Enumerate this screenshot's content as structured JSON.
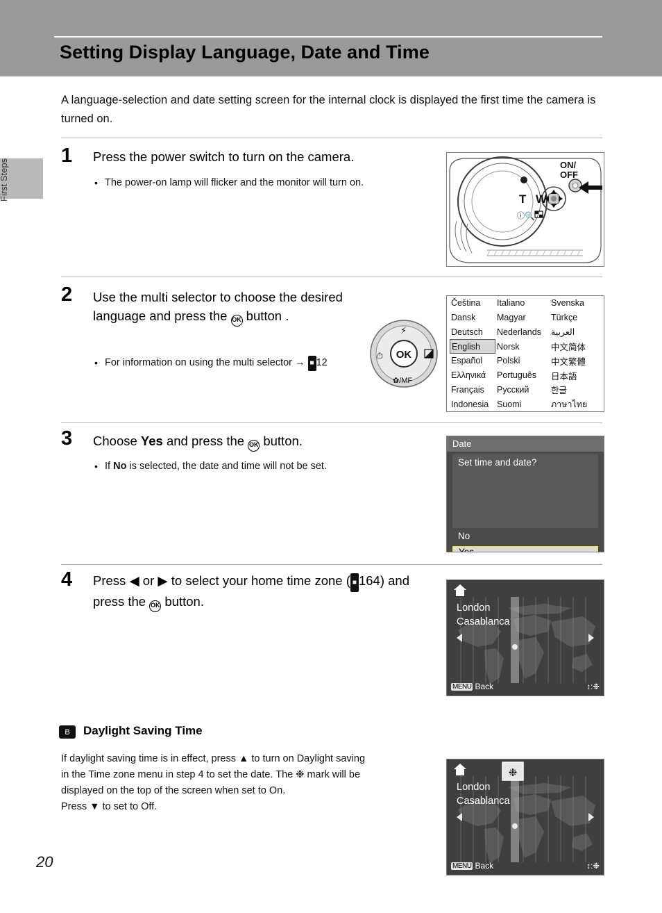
{
  "header": {
    "title": "Setting Display Language, Date and Time"
  },
  "side_tab": {
    "label": "First Steps"
  },
  "intro": "A language-selection and date setting screen for the internal clock is displayed the first time the camera is turned on.",
  "steps": [
    {
      "number": "1",
      "title": "Press the power switch to turn on the camera.",
      "bullet": "The power-on lamp will flicker and the monitor will turn on.",
      "illustration": {
        "labels": [
          "ON/",
          "OFF",
          "T",
          "W"
        ],
        "icons": [
          "zoom-tele-icon",
          "zoom-wide-icon",
          "help-icon",
          "magnifier-icon",
          "thumbnail-icon",
          "arrow-left-icon"
        ]
      }
    },
    {
      "number": "2",
      "title_pre": "Use the multi selector to choose the desired language and press the ",
      "title_post": " button .",
      "bullet_pre": "For information on using the multi selector ",
      "bullet_arrow": "→",
      "bullet_ref": "12",
      "dial_labels": [
        "flash-icon",
        "self-timer-icon",
        "exposure-icon",
        "macro-mf-icon",
        "OK"
      ]
    },
    {
      "number": "3",
      "title_pre": "Choose ",
      "title_bold": "Yes",
      "title_post": " and press the ",
      "title_end": " button.",
      "bullet_pre": "If ",
      "bullet_bold": "No",
      "bullet_post": " is selected, the date and time will not be set."
    },
    {
      "number": "4",
      "title_line1_pre": "Press ",
      "title_left": "◀",
      "title_or": " or ",
      "title_right": "▶",
      "title_line1_post": " to select your home time zone",
      "title_line2_pre": "(",
      "title_ref": "164",
      "title_line2_post": ") and press the ",
      "title_line2_end": " button."
    }
  ],
  "screens": {
    "language": {
      "selected": "English",
      "columns": [
        [
          "Čeština",
          "Dansk",
          "Deutsch",
          "English",
          "Español",
          "Ελληνικά",
          "Français",
          "Indonesia"
        ],
        [
          "Italiano",
          "Magyar",
          "Nederlands",
          "Norsk",
          "Polski",
          "Português",
          "Русский",
          "Suomi"
        ],
        [
          "Svenska",
          "Türkçe",
          "العربية",
          "中文简体",
          "中文繁體",
          "日本語",
          "한글",
          "ภาษาไทย"
        ]
      ]
    },
    "date": {
      "title": "Date",
      "question": "Set time and date?",
      "option_no": "No",
      "option_yes": "Yes"
    },
    "timezone": {
      "city_line1": "London",
      "city_line2": "Casablanca",
      "back_chip": "MENU",
      "back_label": "Back",
      "hint": "↕:",
      "home_icon": "home-icon"
    },
    "timezone_dst": {
      "city_line1": "London",
      "city_line2": "Casablanca",
      "back_chip": "MENU",
      "back_label": "Back",
      "hint": "↕:",
      "dst_icon": "daylight-saving-icon"
    }
  },
  "note": {
    "icon_label": "B",
    "title": "Daylight Saving Time",
    "line1": "If daylight saving time is in effect, press ▲ to turn on Daylight saving",
    "line2_pre": "in the Time zone menu in step 4 to set the date. The ",
    "line2_post": " mark will be",
    "line3": "displayed on the top of the screen when set to On.",
    "line4": "Press ▼ to set to Off."
  },
  "footer": {
    "page_number": "20"
  }
}
